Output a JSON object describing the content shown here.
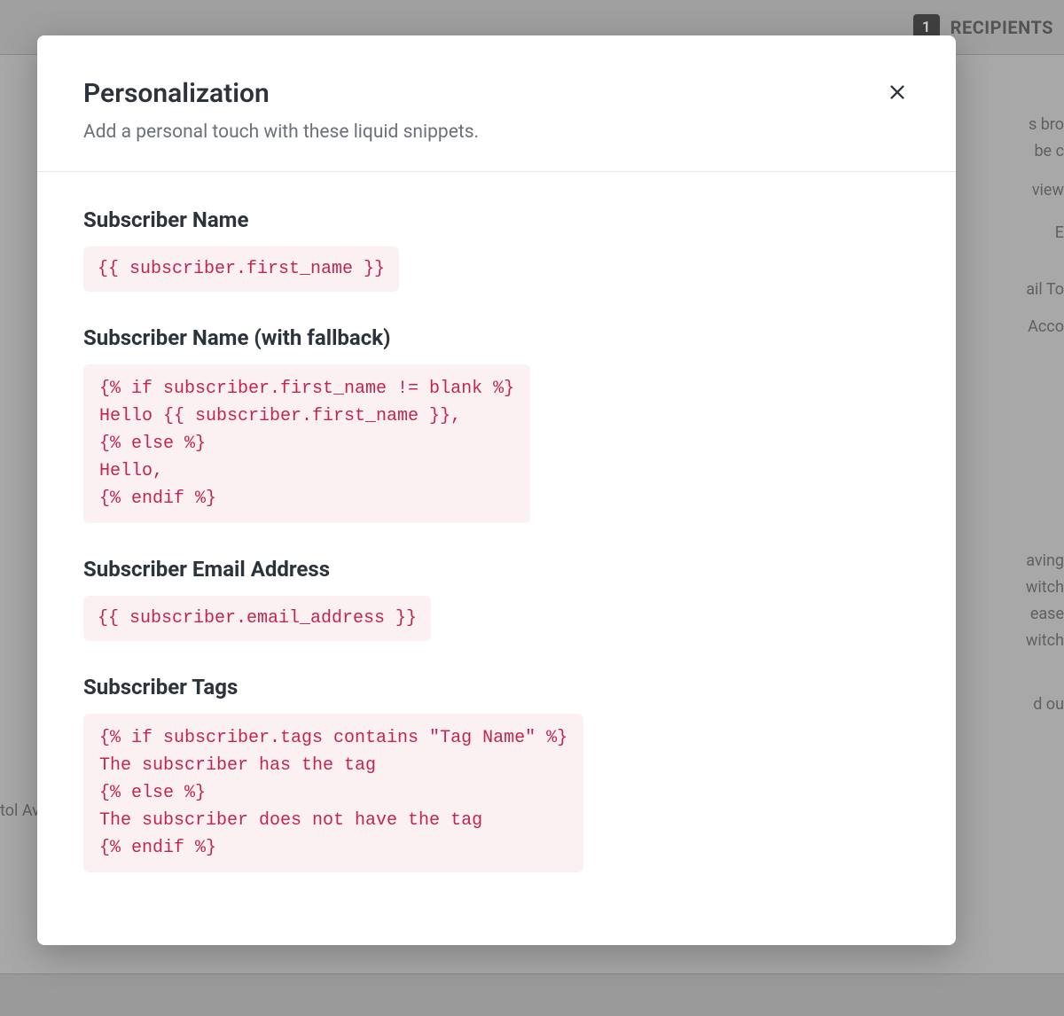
{
  "background": {
    "step_number": "1",
    "step_label": "RECIPIENTS",
    "right_lines": {
      "line1": "s bro",
      "line2": "be c",
      "line3": "view",
      "line4": "E",
      "line5": "ail To",
      "line6": "Acco",
      "line7": "aving",
      "line8": "witch",
      "line9": "ease",
      "line10": "witch",
      "line11": "d ou"
    },
    "left_text": "tol Av"
  },
  "modal": {
    "title": "Personalization",
    "subtitle": "Add a personal touch with these liquid snippets.",
    "sections": [
      {
        "title": "Subscriber Name",
        "code": "{{ subscriber.first_name }}"
      },
      {
        "title": "Subscriber Name (with fallback)",
        "code": "{% if subscriber.first_name != blank %}\nHello {{ subscriber.first_name }},\n{% else %}\nHello,\n{% endif %}"
      },
      {
        "title": "Subscriber Email Address",
        "code": "{{ subscriber.email_address }}"
      },
      {
        "title": "Subscriber Tags",
        "code": "{% if subscriber.tags contains \"Tag Name\" %}\nThe subscriber has the tag\n{% else %}\nThe subscriber does not have the tag\n{% endif %}"
      }
    ]
  }
}
